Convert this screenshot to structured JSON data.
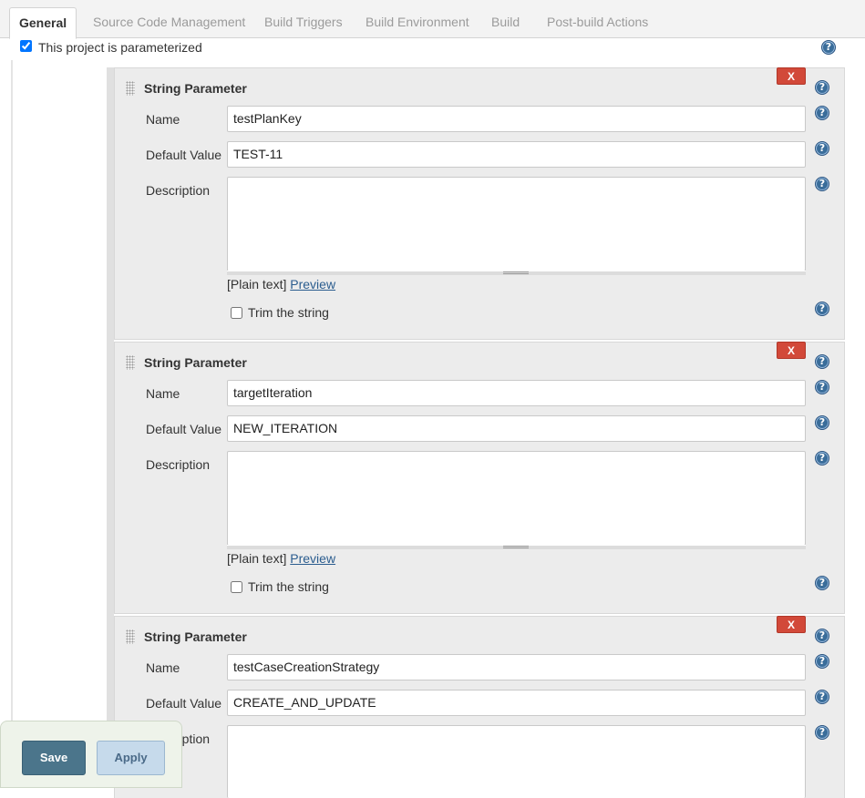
{
  "tabs": [
    {
      "label": "General",
      "active": true
    },
    {
      "label": "Source Code Management"
    },
    {
      "label": "Build Triggers"
    },
    {
      "label": "Build Environment"
    },
    {
      "label": "Build"
    },
    {
      "label": "Post-build Actions"
    }
  ],
  "parameterized": {
    "label": "This project is parameterized",
    "checked": true
  },
  "help_glyph": "?",
  "delete_label": "X",
  "fields": {
    "name_label": "Name",
    "default_value_label": "Default Value",
    "description_label": "Description",
    "plain_text_label": "[Plain text]",
    "preview_label": "Preview",
    "trim_label": "Trim the string"
  },
  "parameters": [
    {
      "type": "String Parameter",
      "name": "testPlanKey",
      "default_value": "TEST-11",
      "description": "",
      "trim": false
    },
    {
      "type": "String Parameter",
      "name": "targetIteration",
      "default_value": "NEW_ITERATION",
      "description": "",
      "trim": false
    },
    {
      "type": "String Parameter",
      "name": "testCaseCreationStrategy",
      "default_value": "CREATE_AND_UPDATE",
      "description": ""
    }
  ],
  "buttons": {
    "save": "Save",
    "apply": "Apply"
  },
  "colors": {
    "delete": "#d24939",
    "save": "#4b758b",
    "apply": "#c6daeb",
    "help": "#3a6d9a"
  }
}
